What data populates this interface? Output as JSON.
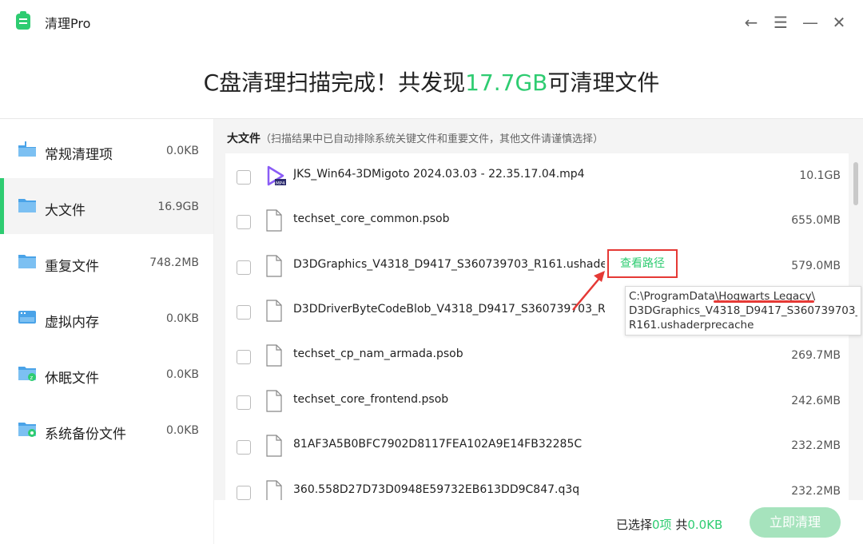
{
  "app": {
    "title": "清理Pro"
  },
  "window_controls": {
    "back": "←",
    "menu": "☰",
    "minimize": "—",
    "close": "✕"
  },
  "headline": {
    "prefix": "C盘清理扫描完成！共发现",
    "amount": "17.7GB",
    "suffix": "可清理文件"
  },
  "sidebar": {
    "items": [
      {
        "label": "常规清理项",
        "size": "0.0KB",
        "icon": "broom-folder-icon",
        "active": false
      },
      {
        "label": "大文件",
        "size": "16.9GB",
        "icon": "folder-icon",
        "active": true
      },
      {
        "label": "重复文件",
        "size": "748.2MB",
        "icon": "duplicate-folder-icon",
        "active": false
      },
      {
        "label": "虚拟内存",
        "size": "0.0KB",
        "icon": "memory-icon",
        "active": false
      },
      {
        "label": "休眠文件",
        "size": "0.0KB",
        "icon": "sleep-folder-icon",
        "active": false
      },
      {
        "label": "系统备份文件",
        "size": "0.0KB",
        "icon": "backup-folder-icon",
        "active": false
      }
    ]
  },
  "section": {
    "title": "大文件",
    "note": "（扫描结果中已自动排除系统关键文件和重要文件，其他文件请谨慎选择）"
  },
  "files": [
    {
      "name": "JKS_Win64-3DMigoto 2024.03.03 - 22.35.17.04.mp4",
      "size": "10.1GB",
      "icon": "video-file-icon",
      "icon_badge": "MP4"
    },
    {
      "name": "techset_core_common.psob",
      "size": "655.0MB",
      "icon": "file-icon"
    },
    {
      "name": "D3DGraphics_V4318_D9417_S360739703_R161.ushade...",
      "size": "579.0MB",
      "icon": "file-icon"
    },
    {
      "name": "D3DDriverByteCodeBlob_V4318_D9417_S360739703_R...",
      "size": "",
      "icon": "file-icon"
    },
    {
      "name": "techset_cp_nam_armada.psob",
      "size": "269.7MB",
      "icon": "file-icon"
    },
    {
      "name": "techset_core_frontend.psob",
      "size": "242.6MB",
      "icon": "file-icon"
    },
    {
      "name": "81AF3A5B0BFC7902D8117FEA102A9E14FB32285C",
      "size": "232.2MB",
      "icon": "file-icon"
    },
    {
      "name": "360.558D27D73D0948E59732EB613DD9C847.q3q",
      "size": "232.2MB",
      "icon": "file-icon"
    }
  ],
  "view_path_label": "查看路径",
  "tooltip": {
    "lines": [
      "C:\\ProgramData\\Hogwarts Legacy\\",
      "D3DGraphics_V4318_D9417_S360739703_",
      "R161.ushaderprecache"
    ]
  },
  "footer": {
    "selected_prefix": "已选择",
    "selected_count": "0项",
    "total_prefix": "共",
    "total_size": "0.0KB",
    "clean_label": "立即清理"
  },
  "colors": {
    "accent": "#2ecc71",
    "annotation": "#e53935"
  }
}
